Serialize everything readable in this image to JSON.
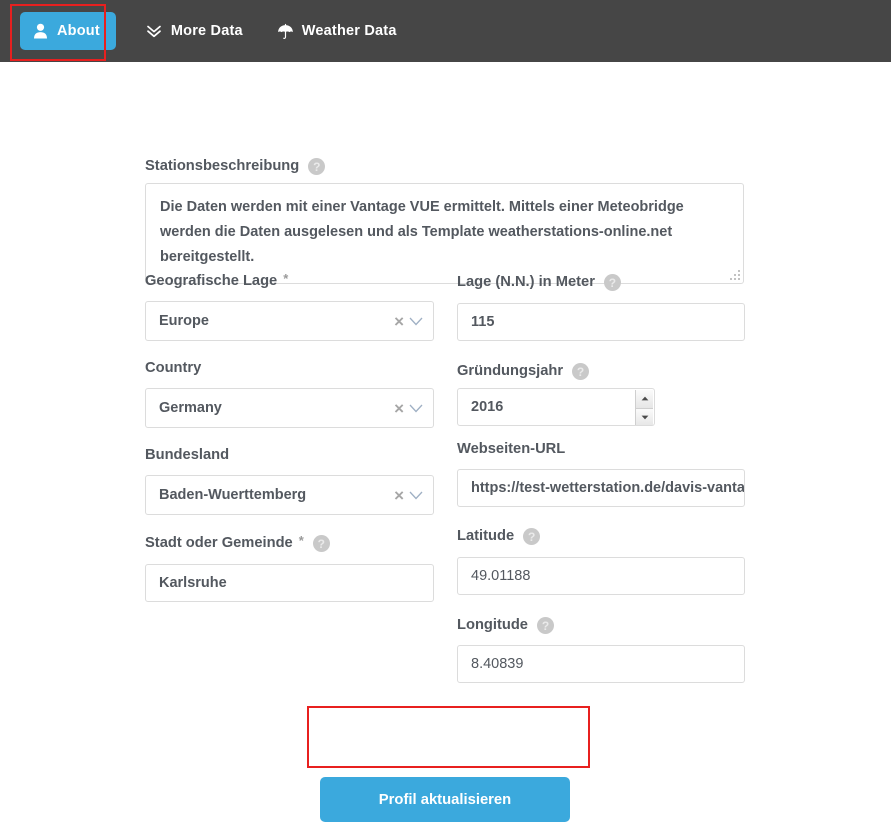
{
  "navbar": {
    "background_color": "#464646",
    "items": [
      {
        "label": "About",
        "icon": "user-icon",
        "active": true
      },
      {
        "label": "More Data",
        "icon": "double-chevron-down-icon",
        "active": false
      },
      {
        "label": "Weather Data",
        "icon": "umbrella-icon",
        "active": false
      }
    ]
  },
  "form": {
    "description": {
      "label": "Stationsbeschreibung",
      "help": "?",
      "value": "Die Daten werden mit einer Vantage VUE ermittelt. Mittels einer Meteobridge werden die Daten ausgelesen und als Template weatherstations-online.net bereitgestellt."
    },
    "left_column": [
      {
        "label": "Geografische Lage",
        "required_marker": "*",
        "type": "select",
        "value": "Europe",
        "clear": "×"
      },
      {
        "label": "Country",
        "type": "select",
        "value": "Germany",
        "clear": "×"
      },
      {
        "label": "Bundesland",
        "type": "select",
        "value": "Baden-Wuerttemberg",
        "clear": "×"
      },
      {
        "label": "Stadt oder Gemeinde",
        "required_marker": "*",
        "help": "?",
        "type": "text",
        "value": "Karlsruhe"
      }
    ],
    "right_column": [
      {
        "label": "Lage (N.N.) in Meter",
        "help": "?",
        "type": "text",
        "value": "115"
      },
      {
        "label": "Gründungsjahr",
        "help": "?",
        "type": "number",
        "value": "2016"
      },
      {
        "label": "Webseiten-URL",
        "type": "text",
        "value": "https://test-wetterstation.de/davis-vanta"
      },
      {
        "label": "Latitude",
        "help": "?",
        "type": "text",
        "value": "49.01188"
      },
      {
        "label": "Longitude",
        "help": "?",
        "type": "text",
        "value": "8.40839"
      }
    ],
    "submit": {
      "label": "Profil aktualisieren",
      "color": "#3ba9dd"
    }
  },
  "annotations": {
    "color": "#e8201f",
    "boxes": [
      "about-nav-button",
      "submit-button"
    ]
  }
}
